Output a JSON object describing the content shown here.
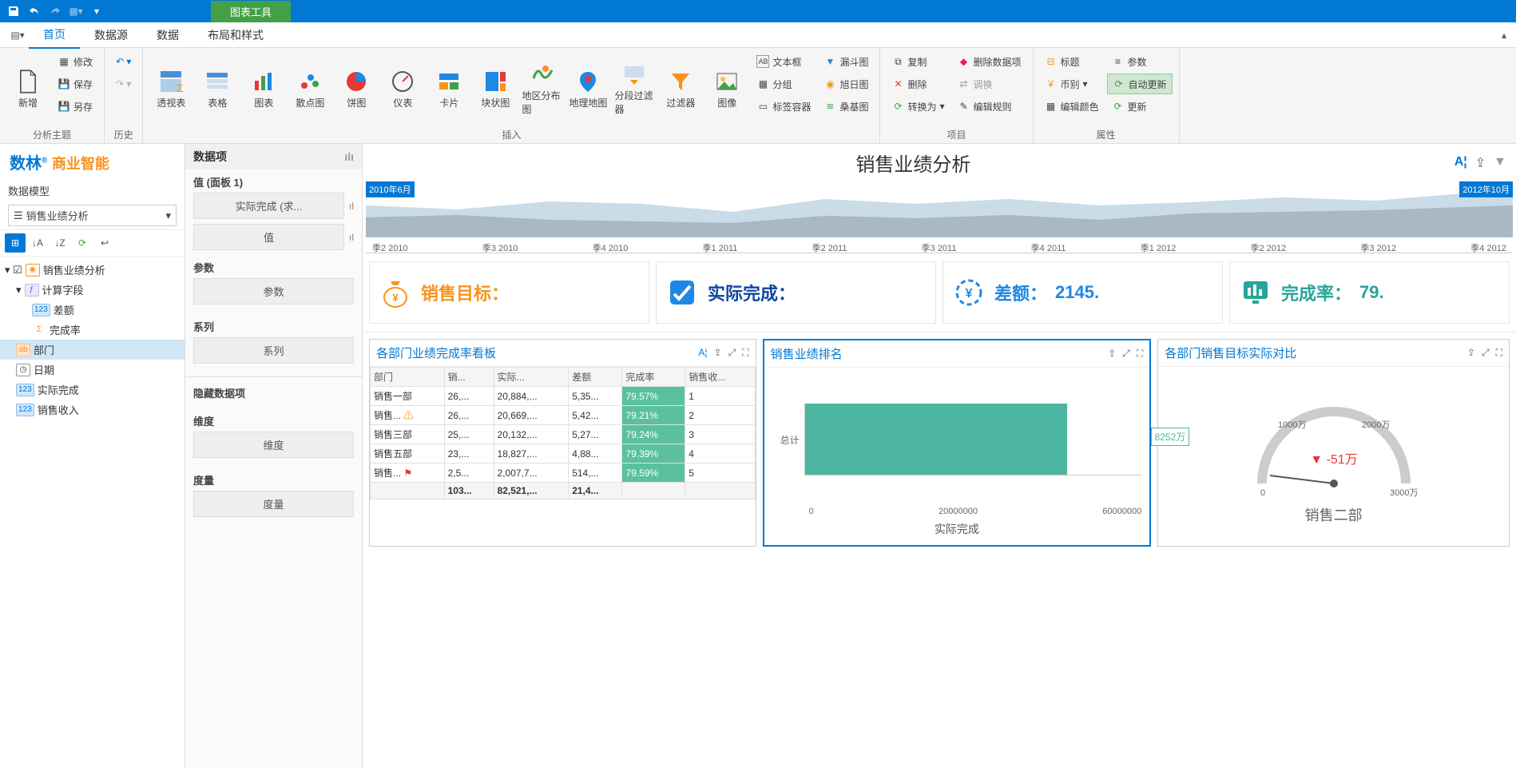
{
  "titlebar": {
    "tool_tab": "图表工具"
  },
  "ribbon_tabs": {
    "home": "首页",
    "datasource": "数据源",
    "data": "数据",
    "layout": "布局和样式"
  },
  "ribbon": {
    "group_analysis": "分析主题",
    "group_history": "历史",
    "group_insert": "插入",
    "group_item": "项目",
    "group_prop": "属性",
    "new": "新增",
    "modify": "修改",
    "save": "保存",
    "saveas": "另存",
    "pivot": "透视表",
    "table": "表格",
    "chart": "图表",
    "scatter": "散点图",
    "pie": "饼图",
    "gauge": "仪表",
    "card": "卡片",
    "block": "块状图",
    "geo": "地区分布图",
    "map": "地理地图",
    "rangefilter": "分段过滤器",
    "filter": "过滤器",
    "image": "图像",
    "textbox": "文本框",
    "group": "分组",
    "tabcontainer": "标签容器",
    "funnel": "漏斗图",
    "sunburst": "旭日图",
    "sankey": "桑基图",
    "copy": "复制",
    "delete": "删除",
    "convert": "转换为",
    "deldata": "删除数据项",
    "adjust": "调换",
    "editrule": "编辑规则",
    "title": "标题",
    "currency": "币别",
    "editcolor": "编辑颜色",
    "param": "参数",
    "autoupdate": "自动更新",
    "refresh": "更新"
  },
  "sidebar": {
    "brand1": "数林",
    "brand2": "商业智能",
    "model_label": "数据模型",
    "model_value": "销售业绩分析",
    "tree": {
      "root": "销售业绩分析",
      "calc": "计算字段",
      "diff": "差额",
      "rate": "完成率",
      "dept": "部门",
      "date": "日期",
      "actual": "实际完成",
      "revenue": "销售收入"
    }
  },
  "datapanel": {
    "header": "数据项",
    "value_panel": "值 (面板 1)",
    "slot_actual": "实际完成 (求...",
    "slot_value": "值",
    "params": "参数",
    "slot_params": "参数",
    "series": "系列",
    "slot_series": "系列",
    "hidden": "隐藏数据项",
    "dim": "维度",
    "slot_dim": "维度",
    "measure": "度量",
    "slot_measure": "度量"
  },
  "canvas": {
    "title": "销售业绩分析",
    "time_from": "2010年6月",
    "time_to": "2012年10月",
    "time_axis": [
      "季2 2010",
      "季3 2010",
      "季4 2010",
      "季1 2011",
      "季2 2011",
      "季3 2011",
      "季4 2011",
      "季1 2012",
      "季2 2012",
      "季3 2012",
      "季4 2012"
    ],
    "kpi": {
      "target": "销售目标：",
      "actual": "实际完成：",
      "diff_label": "差额：",
      "diff_value": "2145.",
      "rate_label": "完成率：",
      "rate_value": "79."
    },
    "panel1": {
      "title": "各部门业绩完成率看板",
      "cols": [
        "部门",
        "销...",
        "实际...",
        "差额",
        "完成率",
        "销售收..."
      ],
      "rows": [
        [
          "销售一部",
          "26,...",
          "20,884,...",
          "5,35...",
          "79.57%",
          "1"
        ],
        [
          "销售...",
          "26,...",
          "20,669,...",
          "5,42...",
          "79.21%",
          "2"
        ],
        [
          "销售三部",
          "25,...",
          "20,132,...",
          "5,27...",
          "79.24%",
          "3"
        ],
        [
          "销售五部",
          "23,...",
          "18,827,...",
          "4,88...",
          "79.39%",
          "4"
        ],
        [
          "销售...",
          "2,5...",
          "2,007,7...",
          "514,...",
          "79.59%",
          "5"
        ]
      ],
      "footer": [
        "",
        "103...",
        "82,521,...",
        "21,4...",
        "",
        ""
      ]
    },
    "panel2": {
      "title": "销售业绩排名",
      "ylabel": "总计",
      "callout": "8252万",
      "xticks": [
        "0",
        "20000000",
        "60000000"
      ],
      "xtitle": "实际完成"
    },
    "panel3": {
      "title": "各部门销售目标实际对比",
      "ticks": [
        "0",
        "1000万",
        "2000万",
        "3000万"
      ],
      "value": "-51万",
      "label": "销售二部"
    }
  },
  "chart_data": [
    {
      "type": "area",
      "title": "销售业绩分析 时间轴",
      "x": [
        "2010-Q2",
        "2010-Q3",
        "2010-Q4",
        "2011-Q1",
        "2011-Q2",
        "2011-Q3",
        "2011-Q4",
        "2012-Q1",
        "2012-Q2",
        "2012-Q3",
        "2012-Q4"
      ],
      "series": [
        {
          "name": "upper",
          "values": [
            48,
            42,
            52,
            50,
            40,
            55,
            50,
            55,
            48,
            52,
            62
          ]
        },
        {
          "name": "lower",
          "values": [
            30,
            35,
            30,
            28,
            25,
            35,
            32,
            35,
            30,
            38,
            45
          ]
        }
      ],
      "ylim": [
        0,
        70
      ],
      "selection": [
        "2010-06",
        "2012-10"
      ]
    },
    {
      "type": "table",
      "title": "各部门业绩完成率看板",
      "columns": [
        "部门",
        "销售目标",
        "实际完成",
        "差额",
        "完成率",
        "销售收入排名"
      ],
      "rows": [
        [
          "销售一部",
          26000000,
          20884000,
          5350000,
          79.57,
          1
        ],
        [
          "销售二部",
          26000000,
          20669000,
          5420000,
          79.21,
          2
        ],
        [
          "销售三部",
          25000000,
          20132000,
          5270000,
          79.24,
          3
        ],
        [
          "销售五部",
          23000000,
          18827000,
          4880000,
          79.39,
          4
        ],
        [
          "销售四部",
          2500000,
          2007700,
          514000,
          79.59,
          5
        ]
      ],
      "totals": [
        null,
        103000000,
        82521000,
        21400000,
        null,
        null
      ]
    },
    {
      "type": "bar",
      "title": "销售业绩排名",
      "orientation": "horizontal",
      "categories": [
        "总计"
      ],
      "values": [
        82520000
      ],
      "xlabel": "实际完成",
      "xlim": [
        0,
        90000000
      ],
      "annotations": [
        "8252万"
      ]
    },
    {
      "type": "gauge",
      "title": "各部门销售目标实际对比",
      "min": 0,
      "max": 30000000,
      "ticks": [
        0,
        10000000,
        20000000,
        30000000
      ],
      "value": -510000,
      "display": "-51万",
      "label": "销售二部"
    }
  ]
}
